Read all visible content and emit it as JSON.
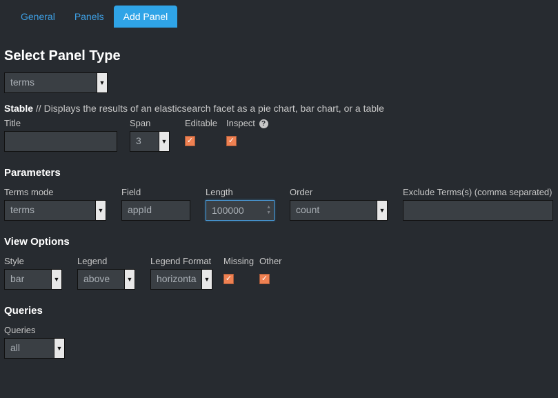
{
  "tabs": {
    "general": "General",
    "panels": "Panels",
    "add_panel": "Add Panel"
  },
  "heading_select_type": "Select Panel Type",
  "panel_type_value": "terms",
  "status_label": "Stable",
  "status_sep": " // ",
  "status_text": "Displays the results of an elasticsearch facet as a pie chart, bar chart, or a table",
  "row1": {
    "title_label": "Title",
    "title_value": "",
    "span_label": "Span",
    "span_value": "3",
    "editable_label": "Editable",
    "inspect_label": "Inspect"
  },
  "heading_params": "Parameters",
  "params": {
    "terms_mode_label": "Terms mode",
    "terms_mode_value": "terms",
    "field_label": "Field",
    "field_value": "appId",
    "length_label": "Length",
    "length_value": "100000",
    "order_label": "Order",
    "order_value": "count",
    "exclude_label": "Exclude Terms(s) (comma separated)",
    "exclude_value": ""
  },
  "heading_view": "View Options",
  "view": {
    "style_label": "Style",
    "style_value": "bar",
    "legend_label": "Legend",
    "legend_value": "above",
    "legend_fmt_label": "Legend Format",
    "legend_fmt_value": "horizonta",
    "missing_label": "Missing",
    "other_label": "Other"
  },
  "heading_queries": "Queries",
  "queries": {
    "label": "Queries",
    "value": "all"
  },
  "checkmark": "✓",
  "caret": "▼",
  "spin_up": "▲",
  "spin_dn": "▼"
}
